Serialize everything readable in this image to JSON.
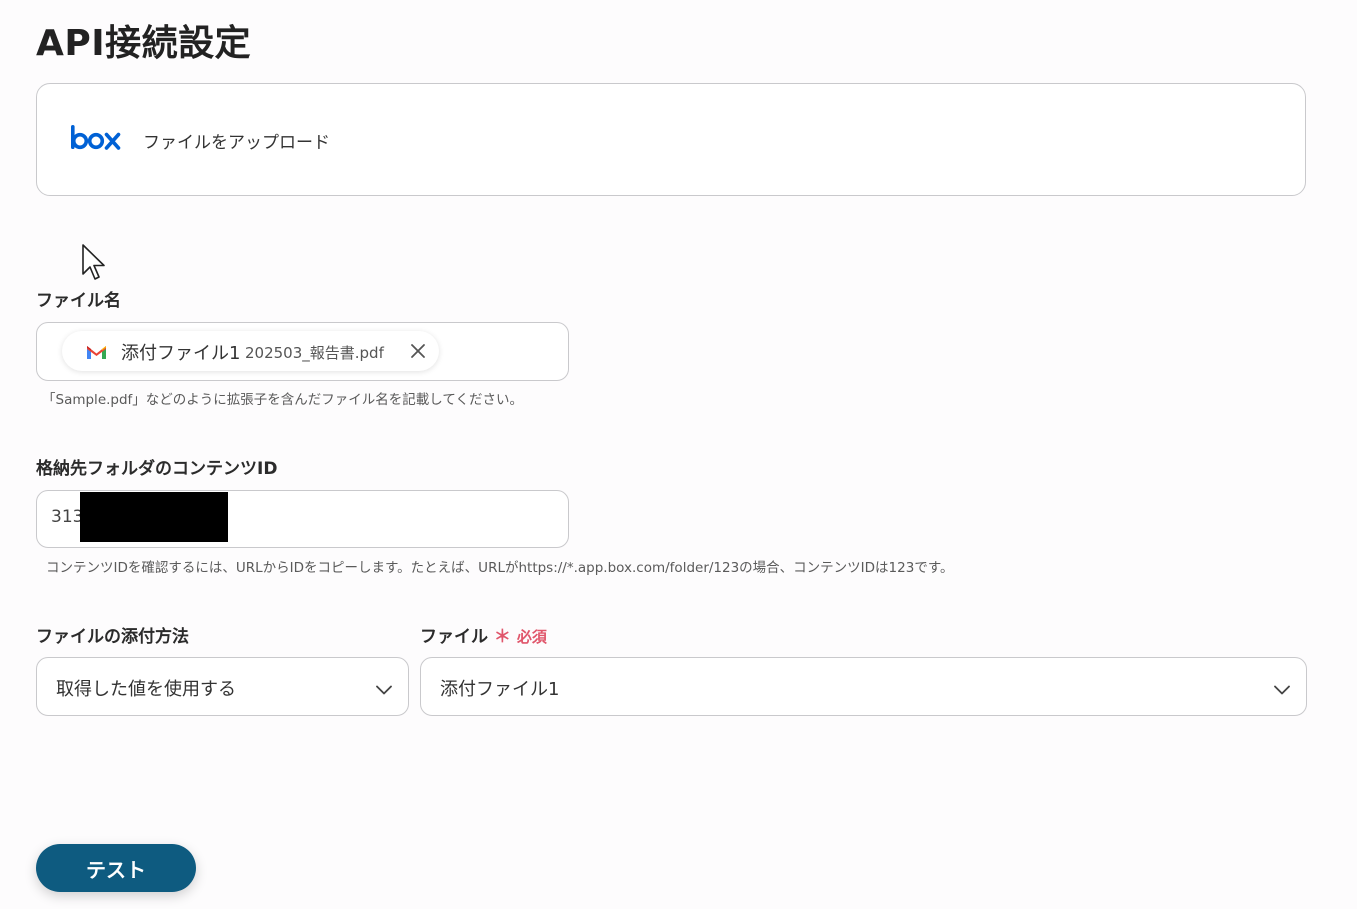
{
  "page": {
    "title": "API接続設定"
  },
  "app": {
    "name": "box",
    "action": "ファイルをアップロード",
    "brand_color": "#0061d5"
  },
  "file_name": {
    "label": "ファイル名",
    "chip": {
      "source_icon": "gmail-icon",
      "label": "添付ファイル1",
      "value": "202503_報告書.pdf"
    },
    "hint": "「Sample.pdf」などのように拡張子を含んだファイル名を記載してください。"
  },
  "folder_id": {
    "label": "格納先フォルダのコンテンツID",
    "value_visible": "313",
    "hint": "コンテンツIDを確認するには、URLからIDをコピーします。たとえば、URLがhttps://*.app.box.com/folder/123の場合、コンテンツIDは123です。"
  },
  "attach_method": {
    "label": "ファイルの添付方法",
    "selected": "取得した値を使用する"
  },
  "file": {
    "label": "ファイル",
    "required_mark": "＊",
    "required_text": "必須",
    "selected": "添付ファイル1"
  },
  "actions": {
    "test_label": "テスト",
    "test_color": "#0e5b80"
  }
}
